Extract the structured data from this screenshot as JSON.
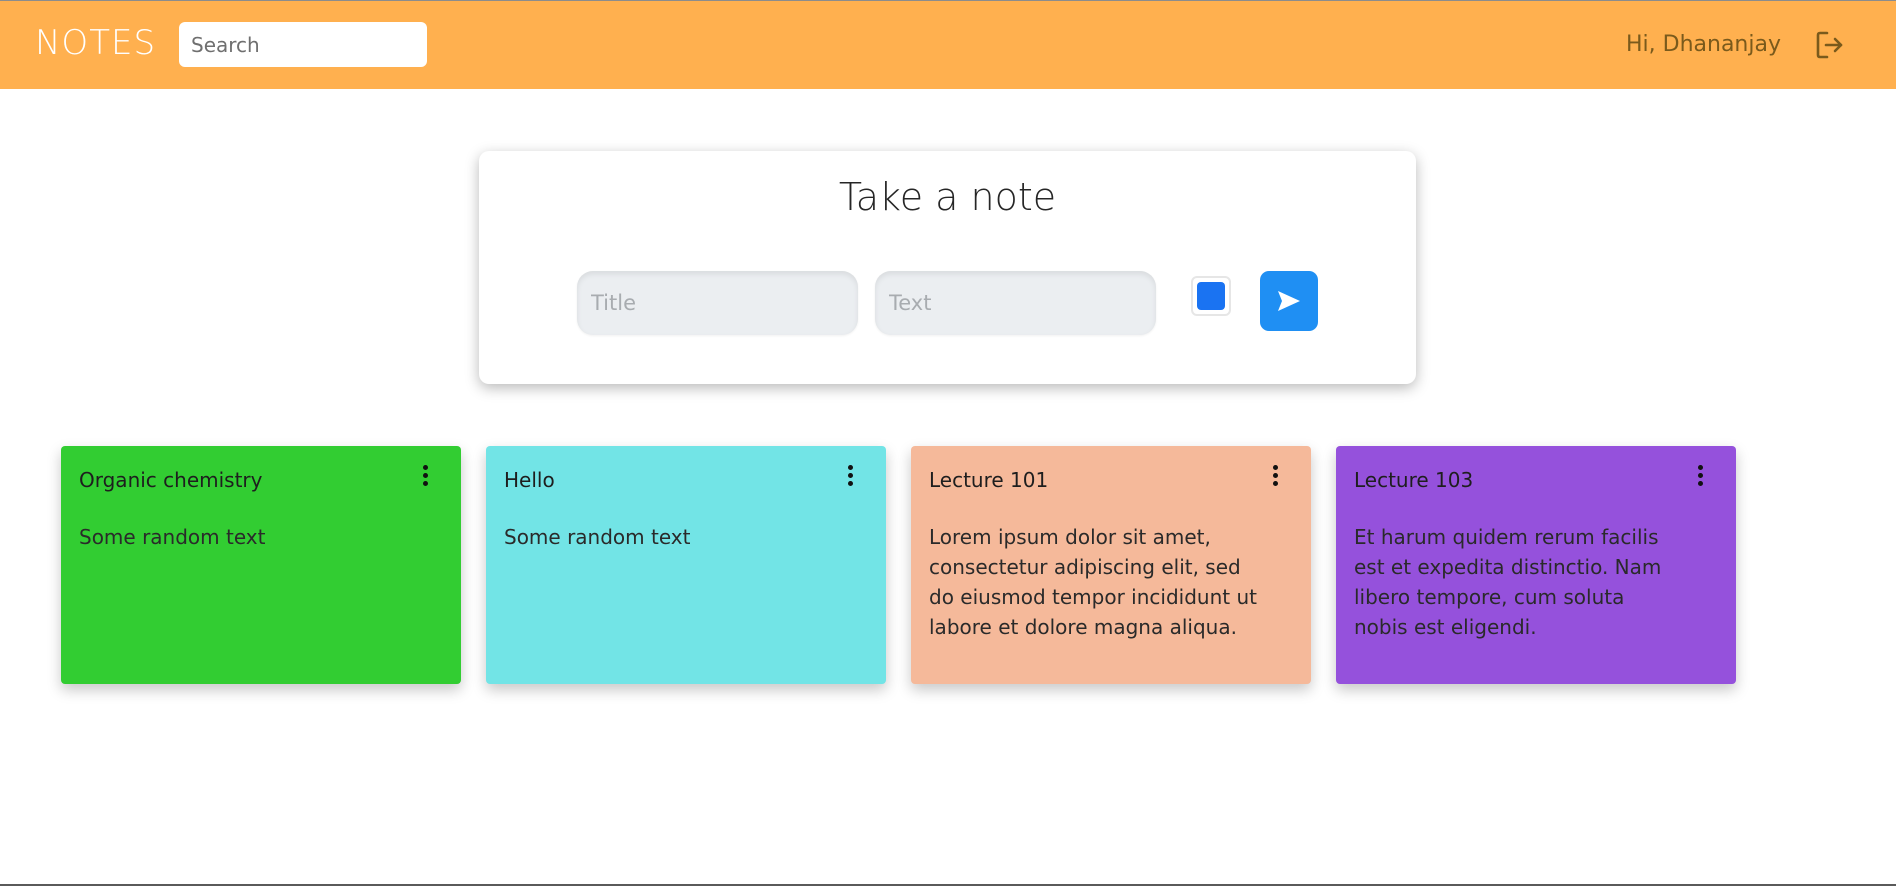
{
  "header": {
    "brand": "NOTES",
    "search_placeholder": "Search",
    "greeting": "Hi, Dhananjay",
    "logout_icon": "logout-icon",
    "background_color": "#ffb04f"
  },
  "composer": {
    "heading": "Take a note",
    "title_placeholder": "Title",
    "text_placeholder": "Text",
    "selected_color": "#1a73f2",
    "send_icon": "send-icon",
    "send_color": "#1f8ff3"
  },
  "notes": [
    {
      "title": "Organic chemistry",
      "text": "Some random text",
      "color": "#32cd32"
    },
    {
      "title": "Hello",
      "text": "Some random text",
      "color": "#72e4e6"
    },
    {
      "title": "Lecture 101",
      "text": "Lorem ipsum dolor sit amet, consectetur adipiscing elit, sed do eiusmod tempor incididunt ut labore et dolore magna aliqua.",
      "color": "#f5b99a"
    },
    {
      "title": "Lecture 103",
      "text": "Et harum quidem rerum facilis est et expedita distinctio. Nam libero tempore, cum soluta nobis est eligendi.",
      "color": "#9551dc"
    }
  ]
}
